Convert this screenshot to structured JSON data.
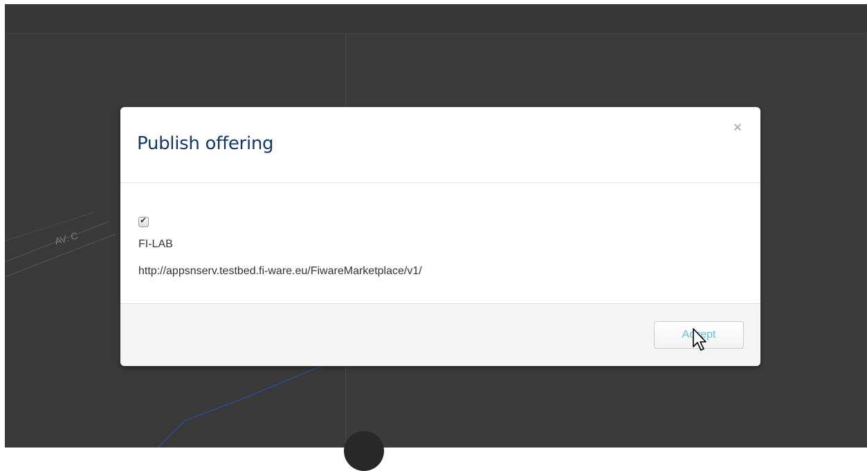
{
  "background": {
    "map_label": "AV. C",
    "colors": {
      "frame": "#3a3a3a",
      "map_road": "#2a4d8a"
    }
  },
  "modal": {
    "title": "Publish offering",
    "close_symbol": "×",
    "marketplace": {
      "checked": true,
      "name": "FI-LAB",
      "url": "http://appsnserv.testbed.fi-ware.eu/FiwareMarketplace/v1/"
    },
    "accept_label": "Accept",
    "colors": {
      "title": "#12386b",
      "accept_text": "#5bc0de"
    }
  },
  "cursor": {
    "icon": "arrow-pointer-icon"
  }
}
